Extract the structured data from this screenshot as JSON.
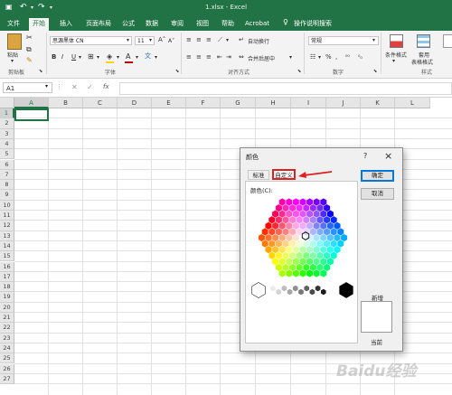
{
  "titlebar": {
    "title": "1.xlsx  -  Excel",
    "undo_label": "↶",
    "redo_label": "↷"
  },
  "tabs": [
    {
      "label": "文件"
    },
    {
      "label": "开始"
    },
    {
      "label": "插入"
    },
    {
      "label": "页面布局"
    },
    {
      "label": "公式"
    },
    {
      "label": "数据"
    },
    {
      "label": "审阅"
    },
    {
      "label": "视图"
    },
    {
      "label": "帮助"
    },
    {
      "label": "Acrobat"
    },
    {
      "label": "操作说明搜索"
    }
  ],
  "ribbon": {
    "paste_label": "粘贴",
    "clipboard_label": "剪贴板",
    "font_name": "思源黑体 CN",
    "font_size": "11",
    "font_group_label": "字体",
    "wrap_text_label": "自动换行",
    "merge_center_label": "合并后居中",
    "alignment_group_label": "对齐方式",
    "number_format": "常规",
    "number_group_label": "数字",
    "conditional_format_label": "条件格式",
    "table_format_label": "套用",
    "table_format_label2": "表格格式",
    "styles_group_label": "样式",
    "font_color": "#c00000",
    "fill_color": "#ffd400"
  },
  "formula_bar": {
    "name_box": "A1",
    "fx_label": "fx",
    "formula": ""
  },
  "sheet": {
    "columns": [
      "A",
      "B",
      "C",
      "D",
      "E",
      "F",
      "G",
      "H",
      "I",
      "J",
      "K",
      "L"
    ],
    "rows": [
      "1",
      "2",
      "3",
      "4",
      "5",
      "6",
      "7",
      "8",
      "9",
      "10",
      "11",
      "12",
      "13",
      "14",
      "15",
      "16",
      "17",
      "18",
      "19",
      "20",
      "21",
      "22",
      "23",
      "24",
      "25",
      "26",
      "27"
    ]
  },
  "dialog": {
    "title": "颜色",
    "help_label": "?",
    "close_label": "×",
    "tab_standard": "标准",
    "tab_custom": "自定义",
    "colors_label": "颜色(C):",
    "ok_label": "确定",
    "cancel_label": "取消",
    "new_label": "新增",
    "current_label": "当前",
    "highlight_color": "#e02020"
  },
  "watermark": "Baidu经验"
}
